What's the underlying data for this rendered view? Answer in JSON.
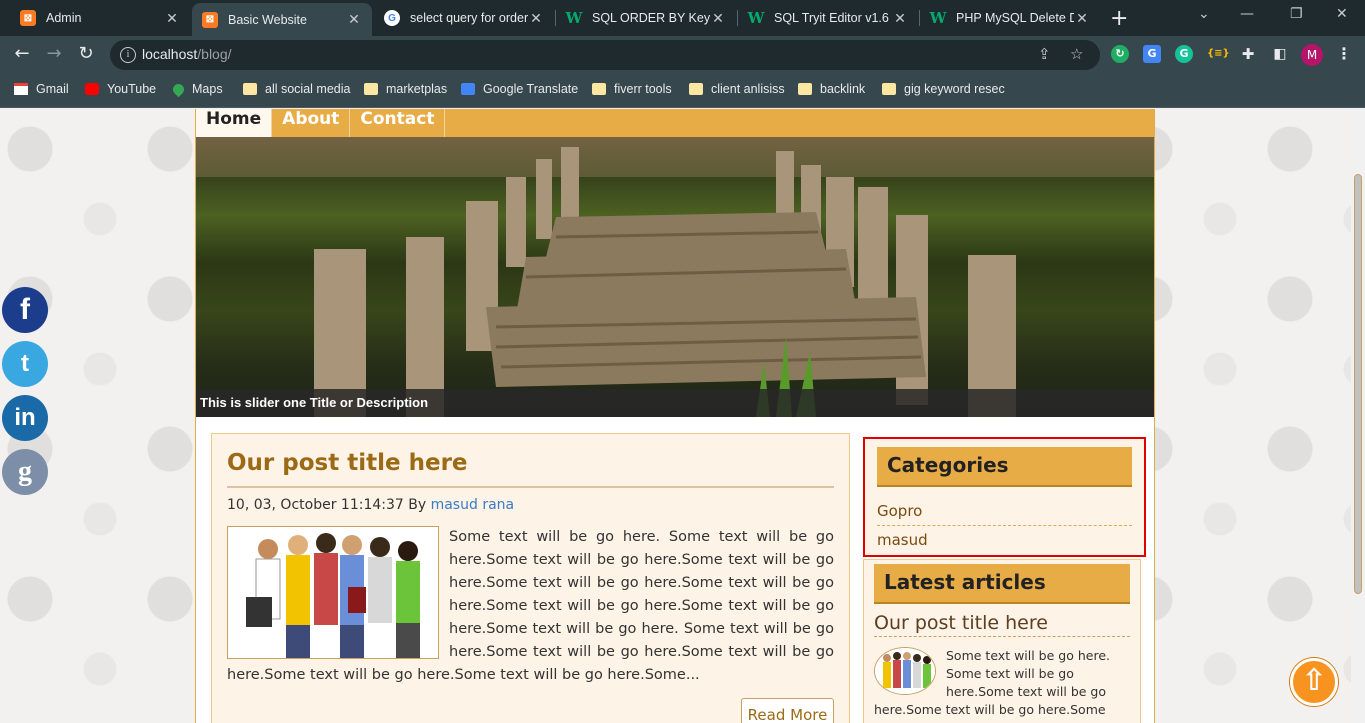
{
  "browser": {
    "tabs": [
      {
        "title": "Admin",
        "favicon": "xampp-icon"
      },
      {
        "title": "Basic Website",
        "favicon": "xampp-icon",
        "active": true
      },
      {
        "title": "select query for order",
        "favicon": "google-icon"
      },
      {
        "title": "SQL ORDER BY Keyw",
        "favicon": "w3schools-icon"
      },
      {
        "title": "SQL Tryit Editor v1.6",
        "favicon": "w3schools-icon"
      },
      {
        "title": "PHP MySQL Delete D",
        "favicon": "w3schools-icon"
      }
    ],
    "url_host": "localhost",
    "url_path": "/blog/",
    "profile_initial": "M",
    "bookmarks": [
      "Gmail",
      "YouTube",
      "Maps",
      "all social media",
      "marketplas",
      "Google Translate",
      "fiverr tools",
      "client anlisiss",
      "backlink",
      "gig keyword resec"
    ]
  },
  "site": {
    "menu": [
      "Home",
      "About",
      "Contact"
    ],
    "slider_caption": "This is slider one Title or Description",
    "post": {
      "title": "Our post title here",
      "date": "10, 03, October 11:14:37",
      "by": "By",
      "author": "masud rana",
      "body": "Some text will be go here. Some text will be go here.Some text will be go here.Some text will be go here.Some text will be go here.Some text will be go here.Some text will be go here.Some text will be go here.Some text will be go here. Some text will be go here.Some text will be go here.Some text will be go here.Some text will be go here.Some text will be go here.Some...",
      "read_more": "Read More"
    },
    "categories": {
      "title": "Categories",
      "items": [
        "Gopro",
        "masud"
      ]
    },
    "latest": {
      "title": "Latest articles",
      "post_title": "Our post title here",
      "excerpt": "Some text will be go here. Some text will be go here.Some text will be go here.Some text will be go here.Some text..."
    }
  },
  "colors": {
    "accent": "#e8ac47",
    "highlight_border": "#e00000",
    "link": "#3b7bc6"
  }
}
